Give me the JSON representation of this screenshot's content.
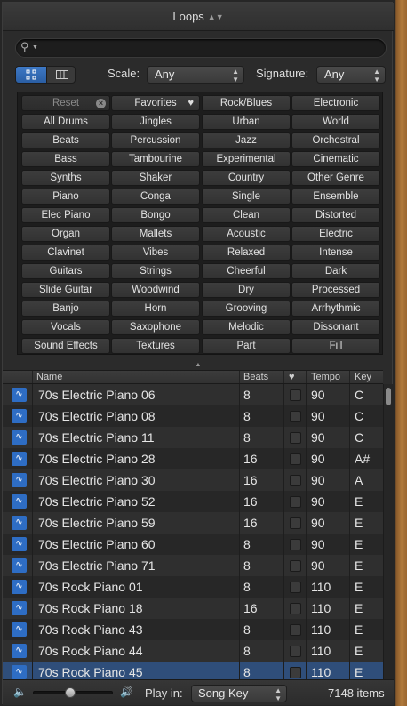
{
  "window": {
    "title": "Loops"
  },
  "search": {
    "placeholder": "",
    "value": ""
  },
  "filters": {
    "scale_label": "Scale:",
    "scale_value": "Any",
    "signature_label": "Signature:",
    "signature_value": "Any"
  },
  "keywords": [
    [
      "Reset",
      "Favorites",
      "Rock/Blues",
      "Electronic"
    ],
    [
      "All Drums",
      "Jingles",
      "Urban",
      "World"
    ],
    [
      "Beats",
      "Percussion",
      "Jazz",
      "Orchestral"
    ],
    [
      "Bass",
      "Tambourine",
      "Experimental",
      "Cinematic"
    ],
    [
      "Synths",
      "Shaker",
      "Country",
      "Other Genre"
    ],
    [
      "Piano",
      "Conga",
      "Single",
      "Ensemble"
    ],
    [
      "Elec Piano",
      "Bongo",
      "Clean",
      "Distorted"
    ],
    [
      "Organ",
      "Mallets",
      "Acoustic",
      "Electric"
    ],
    [
      "Clavinet",
      "Vibes",
      "Relaxed",
      "Intense"
    ],
    [
      "Guitars",
      "Strings",
      "Cheerful",
      "Dark"
    ],
    [
      "Slide Guitar",
      "Woodwind",
      "Dry",
      "Processed"
    ],
    [
      "Banjo",
      "Horn",
      "Grooving",
      "Arrhythmic"
    ],
    [
      "Vocals",
      "Saxophone",
      "Melodic",
      "Dissonant"
    ],
    [
      "Sound Effects",
      "Textures",
      "Part",
      "Fill"
    ]
  ],
  "list": {
    "columns": {
      "name": "Name",
      "beats": "Beats",
      "tempo": "Tempo",
      "key": "Key"
    },
    "rows": [
      {
        "name": "70s Electric Piano 06",
        "beats": "8",
        "tempo": "90",
        "key": "C"
      },
      {
        "name": "70s Electric Piano 08",
        "beats": "8",
        "tempo": "90",
        "key": "C"
      },
      {
        "name": "70s Electric Piano 11",
        "beats": "8",
        "tempo": "90",
        "key": "C"
      },
      {
        "name": "70s Electric Piano 28",
        "beats": "16",
        "tempo": "90",
        "key": "A#"
      },
      {
        "name": "70s Electric Piano 30",
        "beats": "16",
        "tempo": "90",
        "key": "A"
      },
      {
        "name": "70s Electric Piano 52",
        "beats": "16",
        "tempo": "90",
        "key": "E"
      },
      {
        "name": "70s Electric Piano 59",
        "beats": "16",
        "tempo": "90",
        "key": "E"
      },
      {
        "name": "70s Electric Piano 60",
        "beats": "8",
        "tempo": "90",
        "key": "E"
      },
      {
        "name": "70s Electric Piano 71",
        "beats": "8",
        "tempo": "90",
        "key": "E"
      },
      {
        "name": "70s Rock Piano 01",
        "beats": "8",
        "tempo": "110",
        "key": "E"
      },
      {
        "name": "70s Rock Piano 18",
        "beats": "16",
        "tempo": "110",
        "key": "E"
      },
      {
        "name": "70s Rock Piano 43",
        "beats": "8",
        "tempo": "110",
        "key": "E"
      },
      {
        "name": "70s Rock Piano 44",
        "beats": "8",
        "tempo": "110",
        "key": "E"
      },
      {
        "name": "70s Rock Piano 45",
        "beats": "8",
        "tempo": "110",
        "key": "E"
      }
    ],
    "selected_index": 13
  },
  "footer": {
    "play_in_label": "Play in:",
    "play_in_value": "Song Key",
    "item_count": "7148 items"
  },
  "icons": {
    "search": "magnifier-icon",
    "waveform": "audio-loop-icon",
    "favorites": "heart-icon",
    "reset": "clear-icon",
    "volume_low": "speaker-low-icon",
    "volume_high": "speaker-high-icon"
  },
  "colors": {
    "accent": "#2e6dc4",
    "selection": "#2f4e7a"
  }
}
